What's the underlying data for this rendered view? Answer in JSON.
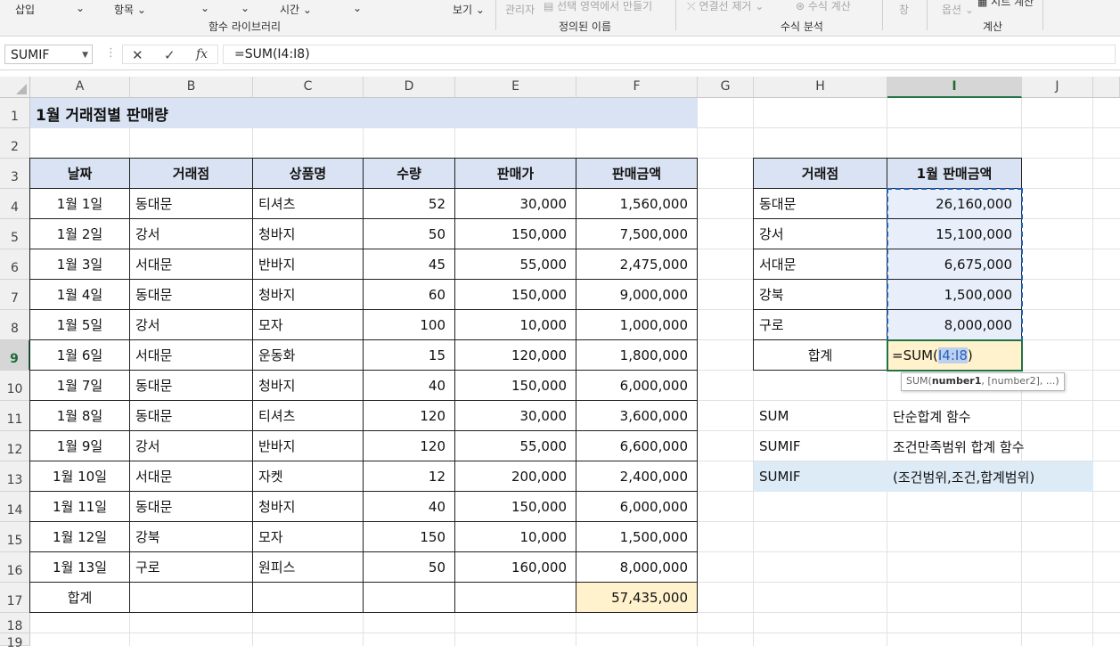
{
  "ribbon": {
    "insert_fn": "삽입",
    "items": "항목",
    "time": "시간",
    "view": "보기",
    "fnlib_group": "함수 라이브러리",
    "name_manager": "관리자",
    "create_from_sel": "선택 영역에서 만들기",
    "defined_names_group": "정의된 이름",
    "remove_arrows": "연결선 제거",
    "eval_formula": "수식 계산",
    "formula_audit_group": "수식 분석",
    "window": "창",
    "options": "옵션",
    "calc_sheet": "시트 계산",
    "calc_group": "계산"
  },
  "formula_bar": {
    "name_box": "SUMIF",
    "cancel_icon": "✕",
    "enter_icon": "✓",
    "fx_icon": "fx",
    "content": "=SUM(I4:I8)"
  },
  "columns": [
    "A",
    "B",
    "C",
    "D",
    "E",
    "F",
    "G",
    "H",
    "I",
    "J"
  ],
  "selected_column": "I",
  "rows": [
    "1",
    "2",
    "3",
    "4",
    "5",
    "6",
    "7",
    "8",
    "9",
    "10",
    "11",
    "12",
    "13",
    "14",
    "15",
    "16",
    "17",
    "18",
    "19"
  ],
  "selected_row": "9",
  "sheet": {
    "title": "1월 거래점별 판매량",
    "headers": [
      "날짜",
      "거래점",
      "상품명",
      "수량",
      "판매가",
      "판매금액"
    ],
    "records": [
      [
        "1월 1일",
        "동대문",
        "티셔츠",
        "52",
        "30,000",
        "1,560,000"
      ],
      [
        "1월 2일",
        "강서",
        "청바지",
        "50",
        "150,000",
        "7,500,000"
      ],
      [
        "1월 3일",
        "서대문",
        "반바지",
        "45",
        "55,000",
        "2,475,000"
      ],
      [
        "1월 4일",
        "동대문",
        "청바지",
        "60",
        "150,000",
        "9,000,000"
      ],
      [
        "1월 5일",
        "강서",
        "모자",
        "100",
        "10,000",
        "1,000,000"
      ],
      [
        "1월 6일",
        "서대문",
        "운동화",
        "15",
        "120,000",
        "1,800,000"
      ],
      [
        "1월 7일",
        "동대문",
        "청바지",
        "40",
        "150,000",
        "6,000,000"
      ],
      [
        "1월 8일",
        "동대문",
        "티셔츠",
        "120",
        "30,000",
        "3,600,000"
      ],
      [
        "1월 9일",
        "강서",
        "반바지",
        "120",
        "55,000",
        "6,600,000"
      ],
      [
        "1월 10일",
        "서대문",
        "자켓",
        "12",
        "200,000",
        "2,400,000"
      ],
      [
        "1월 11일",
        "동대문",
        "청바지",
        "40",
        "150,000",
        "6,000,000"
      ],
      [
        "1월 12일",
        "강북",
        "모자",
        "150",
        "10,000",
        "1,500,000"
      ],
      [
        "1월 13일",
        "구로",
        "원피스",
        "50",
        "160,000",
        "8,000,000"
      ]
    ],
    "total_label": "합계",
    "total_value": "57,435,000"
  },
  "summary": {
    "headers": [
      "거래점",
      "1월 판매금액"
    ],
    "rows": [
      [
        "동대문",
        "26,160,000"
      ],
      [
        "강서",
        "15,100,000"
      ],
      [
        "서대문",
        "6,675,000"
      ],
      [
        "강북",
        "1,500,000"
      ],
      [
        "구로",
        "8,000,000"
      ]
    ],
    "total_label": "합계",
    "edit_prefix": "=SUM(",
    "edit_ref": "I4:I8",
    "edit_suffix": ")"
  },
  "tooltip": {
    "fn": "SUM(",
    "arg1": "number1",
    "rest": ", [number2], ...)"
  },
  "notes": [
    [
      "SUM",
      "단순합계 함수"
    ],
    [
      "SUMIF",
      "조건만족범위 합계 함수"
    ],
    [
      "SUMIF",
      "(조건범위,조건,합계범위)"
    ]
  ]
}
